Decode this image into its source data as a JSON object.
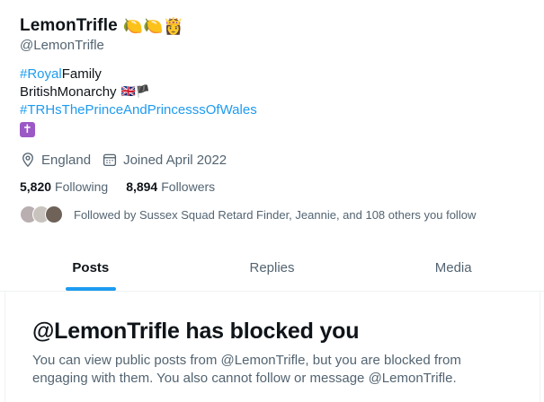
{
  "profile": {
    "display_name": "LemonTrifle",
    "name_emojis": [
      "🍋",
      "🍋",
      "👸"
    ],
    "handle": "@LemonTrifle",
    "bio": {
      "line1_hashtag": "#Royal",
      "line1_text": " Family",
      "line2_text": "BritishMonarchy",
      "line2_flags": "🇬🇧🏴",
      "line3_hashtag": "#TRHsThePrinceAndPrincesssOfWales",
      "line4_emoji": "✝"
    },
    "location": "England",
    "joined": "Joined April 2022",
    "following_count": "5,820",
    "following_label": "Following",
    "followers_count": "8,894",
    "followers_label": "Followers",
    "followed_by": "Followed by Sussex Squad Retard Finder, Jeannie, and 108 others you follow"
  },
  "tabs": [
    {
      "label": "Posts",
      "active": true
    },
    {
      "label": "Replies",
      "active": false
    },
    {
      "label": "Media",
      "active": false
    }
  ],
  "blocked": {
    "title": "@LemonTrifle has blocked you",
    "message": "You can view public posts from @LemonTrifle, but you are blocked from engaging with them. You also cannot follow or message @LemonTrifle."
  },
  "colors": {
    "accent": "#1d9bf0",
    "muted_text": "#536471",
    "primary_text": "#0f1419"
  },
  "icons": [
    "location-pin-icon",
    "calendar-icon"
  ]
}
